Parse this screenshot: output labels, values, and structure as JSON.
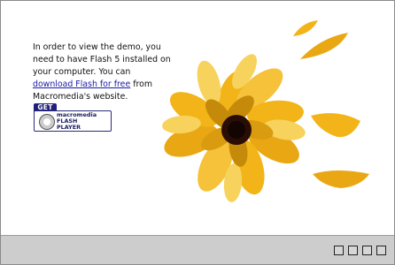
{
  "message": {
    "line1": "In order to view the demo, you",
    "line2": "need to have Flash 5 installed on",
    "line3": "your computer. You can",
    "link": "download Flash for free",
    "after_link": " from",
    "line5": "Macromedia's website."
  },
  "badge": {
    "get": "GET",
    "brand": "macromedia",
    "product_line1": "FLASH",
    "product_line2": "PLAYER"
  },
  "colors": {
    "petal": "#f2b418",
    "petal_light": "#f7d25c",
    "petal_dark": "#c58a0a",
    "center": "#2a0e05",
    "bar": "#cdcdcd"
  },
  "controls": [
    "ctrl-1",
    "ctrl-2",
    "ctrl-3",
    "ctrl-4"
  ]
}
